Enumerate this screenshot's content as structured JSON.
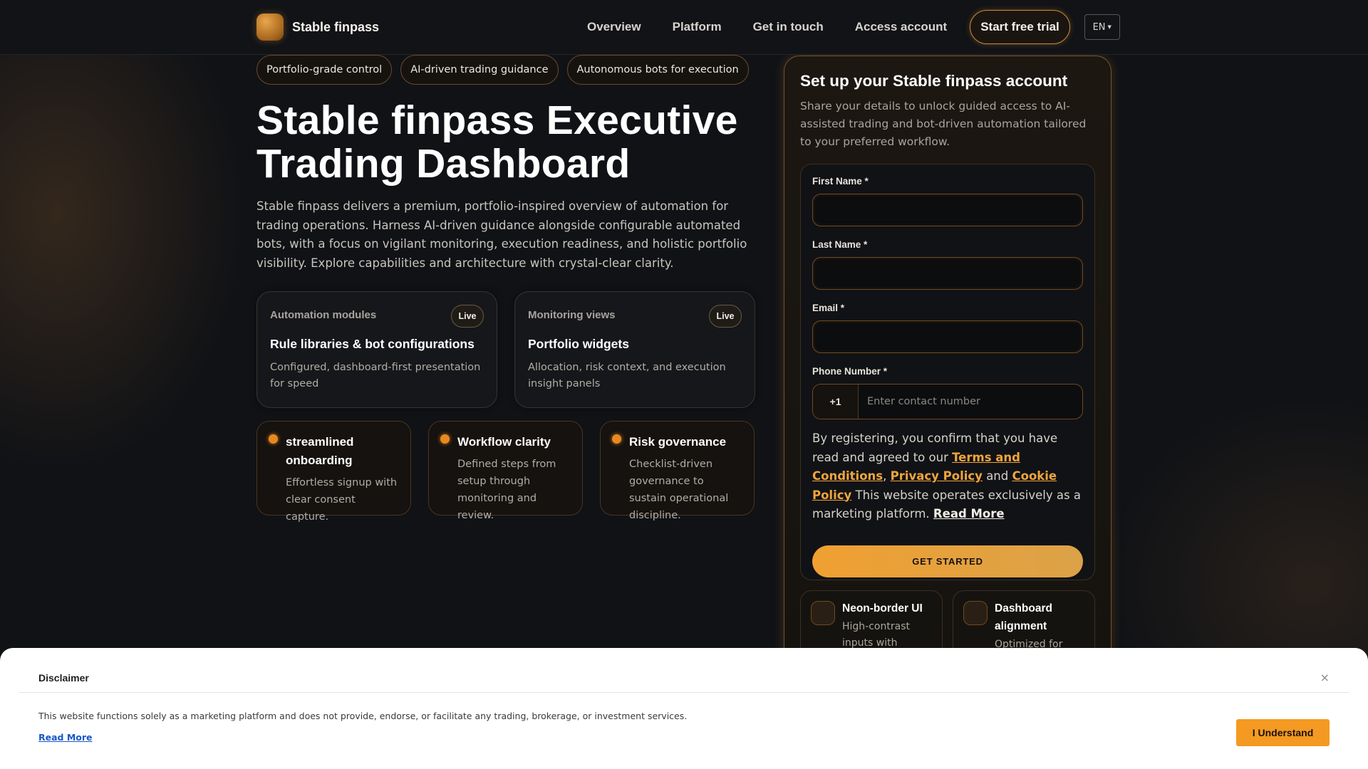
{
  "header": {
    "brand": "Stable finpass",
    "nav": [
      "Overview",
      "Platform",
      "Get in touch",
      "Access account"
    ],
    "trial_button": "Start free trial",
    "language": "EN"
  },
  "hero": {
    "chips": [
      "Portfolio-grade control",
      "AI-driven trading guidance",
      "Autonomous bots for execution"
    ],
    "title": "Stable finpass Executive Trading Dashboard",
    "description": "Stable finpass delivers a premium, portfolio-inspired overview of automation for trading operations. Harness AI-driven guidance alongside configurable automated bots, with a focus on vigilant monitoring, execution readiness, and holistic portfolio visibility. Explore capabilities and architecture with crystal-clear clarity."
  },
  "cards": [
    {
      "kicker": "Automation modules",
      "badge": "Live",
      "title": "Rule libraries & bot configurations",
      "desc": "Configured, dashboard-first presentation for speed"
    },
    {
      "kicker": "Monitoring views",
      "badge": "Live",
      "title": "Portfolio widgets",
      "desc": "Allocation, risk context, and execution insight panels"
    }
  ],
  "features": [
    {
      "title": "streamlined onboarding",
      "desc": "Effortless signup with clear consent capture."
    },
    {
      "title": "Workflow clarity",
      "desc": "Defined steps from setup through monitoring and review."
    },
    {
      "title": "Risk governance",
      "desc": "Checklist-driven governance to sustain operational discipline."
    }
  ],
  "signup": {
    "title": "Set up your Stable finpass account",
    "description": "Share your details to unlock guided access to AI-assisted trading and bot-driven automation tailored to your preferred workflow.",
    "first_name_label": "First Name *",
    "last_name_label": "Last Name *",
    "email_label": "Email *",
    "phone_label": "Phone Number *",
    "phone_code": "+1",
    "phone_placeholder": "Enter contact number",
    "consent_prefix": "By registering, you confirm that you have read and agreed to our ",
    "terms": "Terms and Conditions",
    "comma": ",",
    "privacy": "Privacy Policy",
    "and": " and ",
    "cookie": "Cookie Policy",
    "consent_suffix": " This website operates exclusively as a marketing platform. ",
    "read_more": "Read More",
    "submit": "GET STARTED"
  },
  "mini_cards": [
    {
      "title": "Neon-border UI",
      "desc": "High-contrast inputs with"
    },
    {
      "title": "Dashboard alignment",
      "desc": "Optimized for"
    }
  ],
  "disclaimer": {
    "title": "Disclaimer",
    "close": "×",
    "text": "This website functions solely as a marketing platform and does not provide, endorse, or facilitate any trading, brokerage, or investment services.",
    "read_more": "Read More",
    "button": "I Understand"
  }
}
